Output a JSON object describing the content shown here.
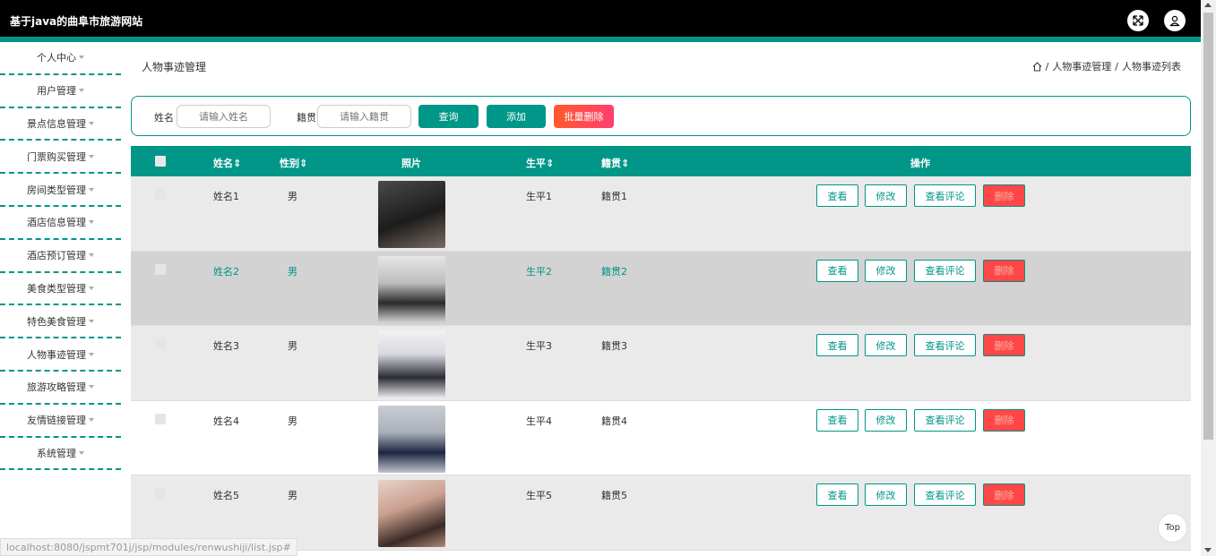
{
  "header": {
    "title": "基于java的曲阜市旅游网站"
  },
  "sidebar": {
    "items": [
      {
        "label": "个人中心"
      },
      {
        "label": "用户管理"
      },
      {
        "label": "景点信息管理"
      },
      {
        "label": "门票购买管理"
      },
      {
        "label": "房间类型管理"
      },
      {
        "label": "酒店信息管理"
      },
      {
        "label": "酒店预订管理"
      },
      {
        "label": "美食类型管理"
      },
      {
        "label": "特色美食管理"
      },
      {
        "label": "人物事迹管理"
      },
      {
        "label": "旅游攻略管理"
      },
      {
        "label": "友情链接管理"
      },
      {
        "label": "系统管理"
      }
    ]
  },
  "page": {
    "title": "人物事迹管理",
    "breadcrumb": {
      "sep": "/",
      "level1": "人物事迹管理",
      "level2": "人物事迹列表"
    }
  },
  "search": {
    "name_label": "姓名",
    "name_placeholder": "请输入姓名",
    "origin_label": "籍贯",
    "origin_placeholder": "请输入籍贯",
    "query_label": "查询",
    "add_label": "添加",
    "batch_delete_label": "批量删除"
  },
  "table": {
    "headers": {
      "name": "姓名",
      "gender": "性别",
      "photo": "照片",
      "bio": "生平",
      "origin": "籍贯",
      "actions": "操作"
    },
    "action_labels": {
      "view": "查看",
      "edit": "修改",
      "comments": "查看评论",
      "delete": "删除"
    },
    "rows": [
      {
        "name": "姓名1",
        "gender": "男",
        "bio": "生平1",
        "origin": "籍贯1"
      },
      {
        "name": "姓名2",
        "gender": "男",
        "bio": "生平2",
        "origin": "籍贯2"
      },
      {
        "name": "姓名3",
        "gender": "男",
        "bio": "生平3",
        "origin": "籍贯3"
      },
      {
        "name": "姓名4",
        "gender": "男",
        "bio": "生平4",
        "origin": "籍贯4"
      },
      {
        "name": "姓名5",
        "gender": "男",
        "bio": "生平5",
        "origin": "籍贯5"
      }
    ]
  },
  "misc": {
    "top_label": "Top",
    "status_url": "localhost:8080/jspmt701j/jsp/modules/renwushiji/list.jsp#"
  },
  "colors": {
    "primary": "#009688",
    "danger": "#ff4747",
    "topbar": "#000000",
    "row_hover": "#d3d3d3",
    "row_alt": "#eaeaea"
  }
}
